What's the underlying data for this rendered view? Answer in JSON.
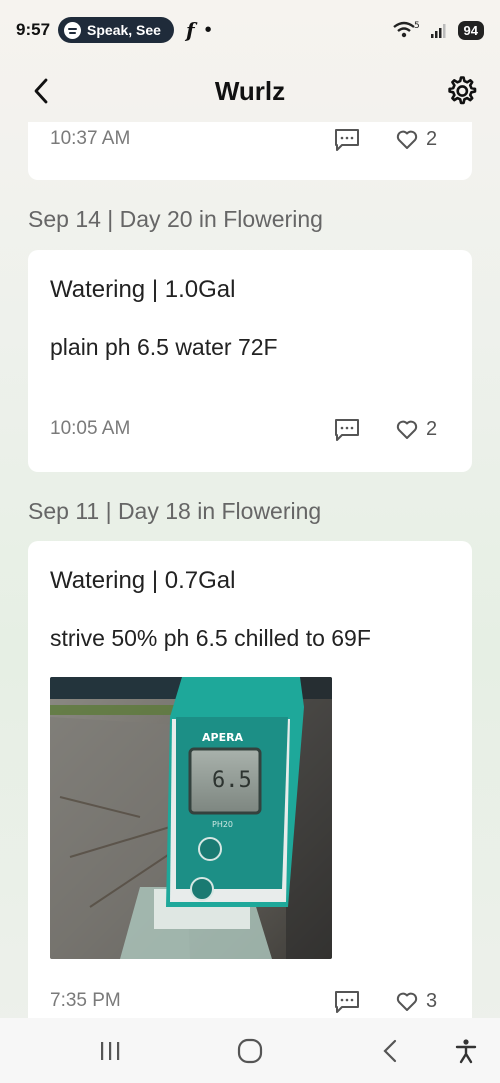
{
  "status_bar": {
    "time": "9:57",
    "media_label": "Speak, See",
    "network": "5",
    "battery": "94"
  },
  "header": {
    "title": "Wurlz"
  },
  "feed": {
    "partial_card": {
      "time": "10:37 AM",
      "likes": "2"
    },
    "entries": [
      {
        "day_header": "Sep 14 | Day 20 in Flowering",
        "title": "Watering | 1.0Gal",
        "note": "plain ph 6.5 water 72F",
        "time": "10:05 AM",
        "likes": "2"
      },
      {
        "day_header": "Sep 11 | Day 18 in Flowering",
        "title": "Watering | 0.7Gal",
        "note": "strive 50% ph 6.5 chilled to 69F",
        "photo_brand": "APERA",
        "photo_reading": "6.5",
        "photo_model": "PH20",
        "time": "7:35 PM",
        "likes": "3"
      }
    ]
  },
  "colors": {
    "meter_teal": "#1ea89a",
    "text_muted": "#7a7a7a",
    "card_bg": "#ffffff"
  }
}
